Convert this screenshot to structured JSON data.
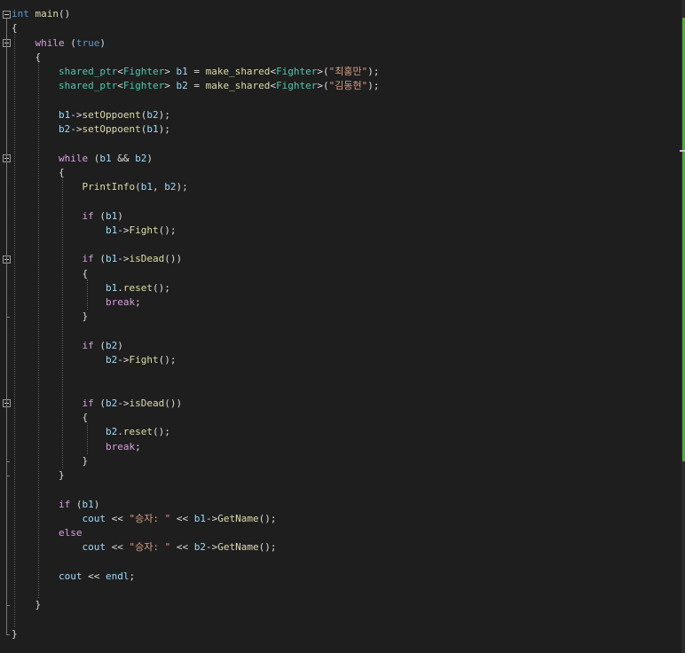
{
  "theme": {
    "background": "#1e1e1e",
    "keyword": "#569cd6",
    "control": "#d8a0df",
    "function": "#dcdcaa",
    "type": "#4ec9b0",
    "variable": "#9cdcfe",
    "string": "#d69d85",
    "plain": "#dcdcdc",
    "gutter_change": "#57a64a"
  },
  "code": [
    {
      "tokens": [
        {
          "t": "int",
          "c": "keyword"
        },
        {
          "t": " "
        },
        {
          "t": "main",
          "c": "function"
        },
        {
          "t": "()"
        }
      ]
    },
    {
      "tokens": [
        {
          "t": "{"
        }
      ]
    },
    {
      "tokens": [
        {
          "t": "    "
        },
        {
          "t": "while",
          "c": "control"
        },
        {
          "t": " ("
        },
        {
          "t": "true",
          "c": "keyword"
        },
        {
          "t": ")"
        }
      ]
    },
    {
      "tokens": [
        {
          "t": "    {"
        }
      ]
    },
    {
      "tokens": [
        {
          "t": "        "
        },
        {
          "t": "shared_ptr",
          "c": "type"
        },
        {
          "t": "<"
        },
        {
          "t": "Fighter",
          "c": "type"
        },
        {
          "t": "> "
        },
        {
          "t": "b1",
          "c": "variable"
        },
        {
          "t": " = "
        },
        {
          "t": "make_shared",
          "c": "function"
        },
        {
          "t": "<"
        },
        {
          "t": "Fighter",
          "c": "type"
        },
        {
          "t": ">("
        },
        {
          "t": "\"최홍만\"",
          "c": "string"
        },
        {
          "t": ");"
        }
      ]
    },
    {
      "tokens": [
        {
          "t": "        "
        },
        {
          "t": "shared_ptr",
          "c": "type"
        },
        {
          "t": "<"
        },
        {
          "t": "Fighter",
          "c": "type"
        },
        {
          "t": "> "
        },
        {
          "t": "b2",
          "c": "variable"
        },
        {
          "t": " = "
        },
        {
          "t": "make_shared",
          "c": "function"
        },
        {
          "t": "<"
        },
        {
          "t": "Fighter",
          "c": "type"
        },
        {
          "t": ">("
        },
        {
          "t": "\"김동현\"",
          "c": "string"
        },
        {
          "t": ");"
        }
      ]
    },
    {
      "tokens": []
    },
    {
      "tokens": [
        {
          "t": "        "
        },
        {
          "t": "b1",
          "c": "variable"
        },
        {
          "t": "->"
        },
        {
          "t": "setOppoent",
          "c": "function"
        },
        {
          "t": "("
        },
        {
          "t": "b2",
          "c": "variable"
        },
        {
          "t": ");"
        }
      ]
    },
    {
      "tokens": [
        {
          "t": "        "
        },
        {
          "t": "b2",
          "c": "variable"
        },
        {
          "t": "->"
        },
        {
          "t": "setOppoent",
          "c": "function"
        },
        {
          "t": "("
        },
        {
          "t": "b1",
          "c": "variable"
        },
        {
          "t": ");"
        }
      ]
    },
    {
      "tokens": []
    },
    {
      "tokens": [
        {
          "t": "        "
        },
        {
          "t": "while",
          "c": "control"
        },
        {
          "t": " ("
        },
        {
          "t": "b1",
          "c": "variable"
        },
        {
          "t": " && "
        },
        {
          "t": "b2",
          "c": "variable"
        },
        {
          "t": ")"
        }
      ]
    },
    {
      "tokens": [
        {
          "t": "        {"
        }
      ]
    },
    {
      "tokens": [
        {
          "t": "            "
        },
        {
          "t": "PrintInfo",
          "c": "function"
        },
        {
          "t": "("
        },
        {
          "t": "b1",
          "c": "variable"
        },
        {
          "t": ", "
        },
        {
          "t": "b2",
          "c": "variable"
        },
        {
          "t": ");"
        }
      ]
    },
    {
      "tokens": []
    },
    {
      "tokens": [
        {
          "t": "            "
        },
        {
          "t": "if",
          "c": "control"
        },
        {
          "t": " ("
        },
        {
          "t": "b1",
          "c": "variable"
        },
        {
          "t": ")"
        }
      ]
    },
    {
      "tokens": [
        {
          "t": "                "
        },
        {
          "t": "b1",
          "c": "variable"
        },
        {
          "t": "->"
        },
        {
          "t": "Fight",
          "c": "function"
        },
        {
          "t": "();"
        }
      ]
    },
    {
      "tokens": []
    },
    {
      "tokens": [
        {
          "t": "            "
        },
        {
          "t": "if",
          "c": "control"
        },
        {
          "t": " ("
        },
        {
          "t": "b1",
          "c": "variable"
        },
        {
          "t": "->"
        },
        {
          "t": "isDead",
          "c": "function"
        },
        {
          "t": "())"
        }
      ]
    },
    {
      "tokens": [
        {
          "t": "            {"
        }
      ]
    },
    {
      "tokens": [
        {
          "t": "                "
        },
        {
          "t": "b1",
          "c": "variable"
        },
        {
          "t": "."
        },
        {
          "t": "reset",
          "c": "function"
        },
        {
          "t": "();"
        }
      ]
    },
    {
      "tokens": [
        {
          "t": "                "
        },
        {
          "t": "break",
          "c": "control"
        },
        {
          "t": ";"
        }
      ]
    },
    {
      "tokens": [
        {
          "t": "            }"
        }
      ]
    },
    {
      "tokens": []
    },
    {
      "tokens": [
        {
          "t": "            "
        },
        {
          "t": "if",
          "c": "control"
        },
        {
          "t": " ("
        },
        {
          "t": "b2",
          "c": "variable"
        },
        {
          "t": ")"
        }
      ]
    },
    {
      "tokens": [
        {
          "t": "                "
        },
        {
          "t": "b2",
          "c": "variable"
        },
        {
          "t": "->"
        },
        {
          "t": "Fight",
          "c": "function"
        },
        {
          "t": "();"
        }
      ]
    },
    {
      "tokens": []
    },
    {
      "tokens": []
    },
    {
      "tokens": [
        {
          "t": "            "
        },
        {
          "t": "if",
          "c": "control"
        },
        {
          "t": " ("
        },
        {
          "t": "b2",
          "c": "variable"
        },
        {
          "t": "->"
        },
        {
          "t": "isDead",
          "c": "function"
        },
        {
          "t": "())"
        }
      ]
    },
    {
      "tokens": [
        {
          "t": "            {"
        }
      ]
    },
    {
      "tokens": [
        {
          "t": "                "
        },
        {
          "t": "b2",
          "c": "variable"
        },
        {
          "t": "."
        },
        {
          "t": "reset",
          "c": "function"
        },
        {
          "t": "();"
        }
      ]
    },
    {
      "tokens": [
        {
          "t": "                "
        },
        {
          "t": "break",
          "c": "control"
        },
        {
          "t": ";"
        }
      ]
    },
    {
      "tokens": [
        {
          "t": "            }"
        }
      ]
    },
    {
      "tokens": [
        {
          "t": "        }"
        }
      ]
    },
    {
      "tokens": []
    },
    {
      "tokens": [
        {
          "t": "        "
        },
        {
          "t": "if",
          "c": "control"
        },
        {
          "t": " ("
        },
        {
          "t": "b1",
          "c": "variable"
        },
        {
          "t": ")"
        }
      ]
    },
    {
      "tokens": [
        {
          "t": "            "
        },
        {
          "t": "cout",
          "c": "variable"
        },
        {
          "t": " << "
        },
        {
          "t": "\"승자: \"",
          "c": "string"
        },
        {
          "t": " << "
        },
        {
          "t": "b1",
          "c": "variable"
        },
        {
          "t": "->"
        },
        {
          "t": "GetName",
          "c": "function"
        },
        {
          "t": "();"
        }
      ]
    },
    {
      "tokens": [
        {
          "t": "        "
        },
        {
          "t": "else",
          "c": "control"
        }
      ]
    },
    {
      "tokens": [
        {
          "t": "            "
        },
        {
          "t": "cout",
          "c": "variable"
        },
        {
          "t": " << "
        },
        {
          "t": "\"승자: \"",
          "c": "string"
        },
        {
          "t": " << "
        },
        {
          "t": "b2",
          "c": "variable"
        },
        {
          "t": "->"
        },
        {
          "t": "GetName",
          "c": "function"
        },
        {
          "t": "();"
        }
      ]
    },
    {
      "tokens": []
    },
    {
      "tokens": [
        {
          "t": "        "
        },
        {
          "t": "cout",
          "c": "variable"
        },
        {
          "t": " << "
        },
        {
          "t": "endl",
          "c": "variable"
        },
        {
          "t": ";"
        }
      ]
    },
    {
      "tokens": []
    },
    {
      "tokens": [
        {
          "t": "    }"
        }
      ]
    },
    {
      "tokens": []
    },
    {
      "tokens": [
        {
          "t": "}"
        }
      ]
    }
  ]
}
